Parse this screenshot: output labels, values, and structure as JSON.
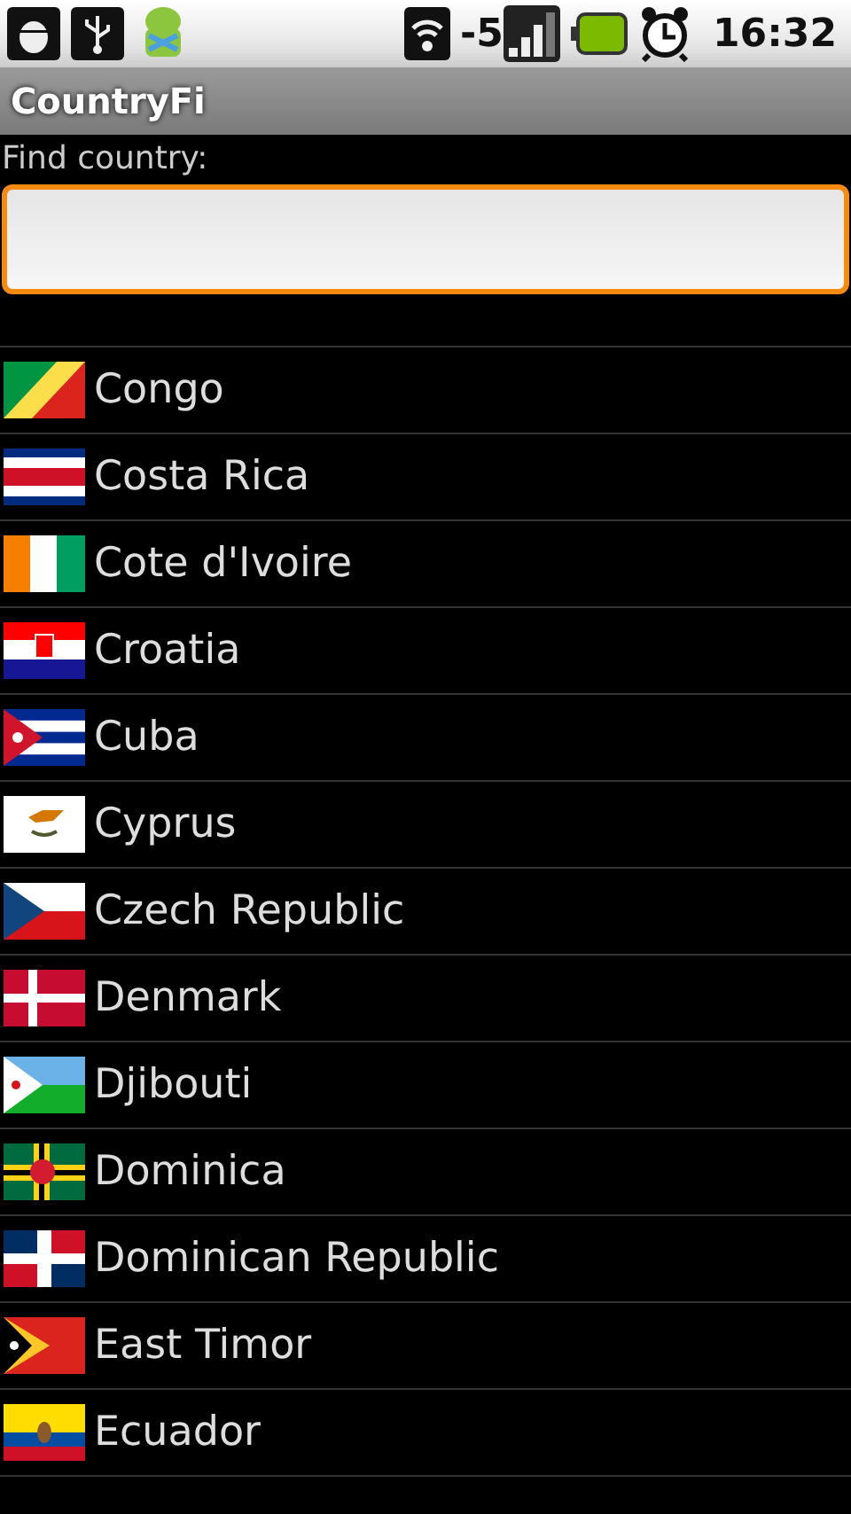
{
  "status_bar": {
    "signal_text": "-5",
    "time": "16:32"
  },
  "title_bar": {
    "title": "CountryFi"
  },
  "search": {
    "label": "Find country:"
  },
  "countries": [
    {
      "name": "Congo"
    },
    {
      "name": "Costa Rica"
    },
    {
      "name": "Cote d'Ivoire"
    },
    {
      "name": "Croatia"
    },
    {
      "name": "Cuba"
    },
    {
      "name": "Cyprus"
    },
    {
      "name": "Czech Republic"
    },
    {
      "name": "Denmark"
    },
    {
      "name": "Djibouti"
    },
    {
      "name": "Dominica"
    },
    {
      "name": "Dominican Republic"
    },
    {
      "name": "East Timor"
    },
    {
      "name": "Ecuador"
    }
  ]
}
